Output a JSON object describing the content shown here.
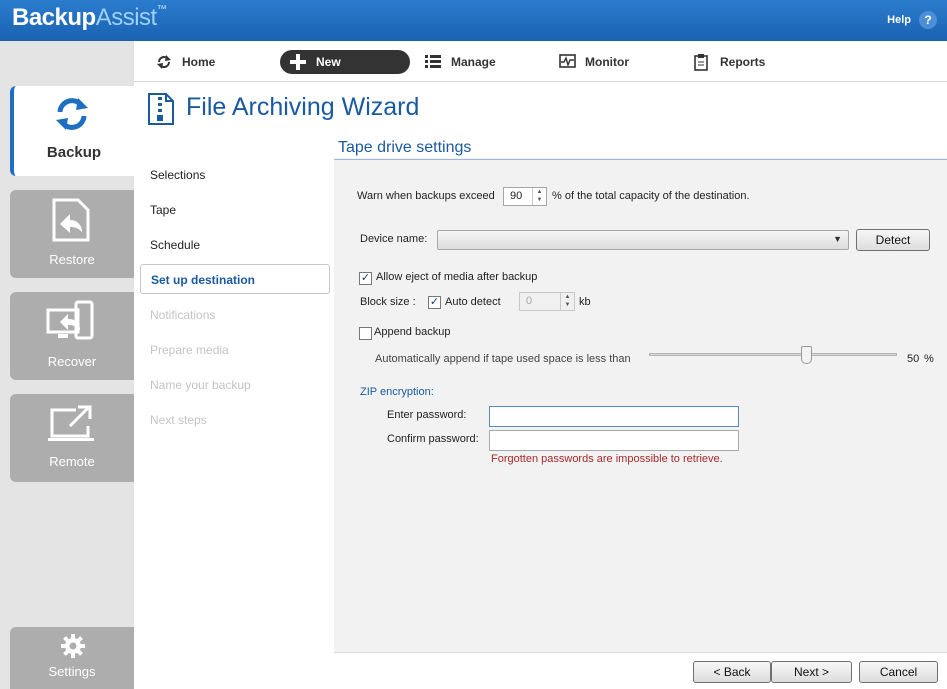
{
  "header": {
    "brand_part1": "Backup",
    "brand_part2": "Assist",
    "brand_tm": "™",
    "help_label": "Help",
    "help_icon_glyph": "?",
    "color": "#1f6fc0"
  },
  "nav": {
    "home": "Home",
    "new": "New",
    "manage": "Manage",
    "monitor": "Monitor",
    "reports": "Reports"
  },
  "sidebar": {
    "backup": "Backup",
    "restore": "Restore",
    "recover": "Recover",
    "remote": "Remote",
    "settings": "Settings"
  },
  "wizard": {
    "title": "File Archiving Wizard",
    "steps": [
      {
        "label": "Selections",
        "state": "done"
      },
      {
        "label": "Tape",
        "state": "done"
      },
      {
        "label": "Schedule",
        "state": "done"
      },
      {
        "label": "Set up destination",
        "state": "active"
      },
      {
        "label": "Notifications",
        "state": "disabled"
      },
      {
        "label": "Prepare media",
        "state": "disabled"
      },
      {
        "label": "Name your backup",
        "state": "disabled"
      },
      {
        "label": "Next steps",
        "state": "disabled"
      }
    ]
  },
  "form": {
    "section_title": "Tape drive settings",
    "warn_prefix": "Warn when backups exceed",
    "warn_value": "90",
    "warn_suffix": "% of the total capacity of the destination.",
    "device_label": "Device name:",
    "device_value": "",
    "detect_button": "Detect",
    "allow_eject_label": "Allow eject of media after backup",
    "allow_eject_checked": true,
    "block_size_label": "Block size :",
    "auto_detect_label": "Auto detect",
    "auto_detect_checked": true,
    "block_size_value": "0",
    "block_size_unit": "kb",
    "append_label": "Append backup",
    "append_checked": false,
    "auto_append_label": "Automatically append if tape used space is less than",
    "auto_append_percent": 50,
    "auto_append_value_text": "50",
    "auto_append_unit": "%",
    "zip_heading": "ZIP encryption:",
    "enter_password_label": "Enter password:",
    "confirm_password_label": "Confirm password:",
    "enter_password_value": "",
    "confirm_password_value": "",
    "password_warning": "Forgotten passwords are impossible to retrieve."
  },
  "footer": {
    "back_button": "< Back",
    "next_button": "Next >",
    "cancel_button": "Cancel"
  }
}
